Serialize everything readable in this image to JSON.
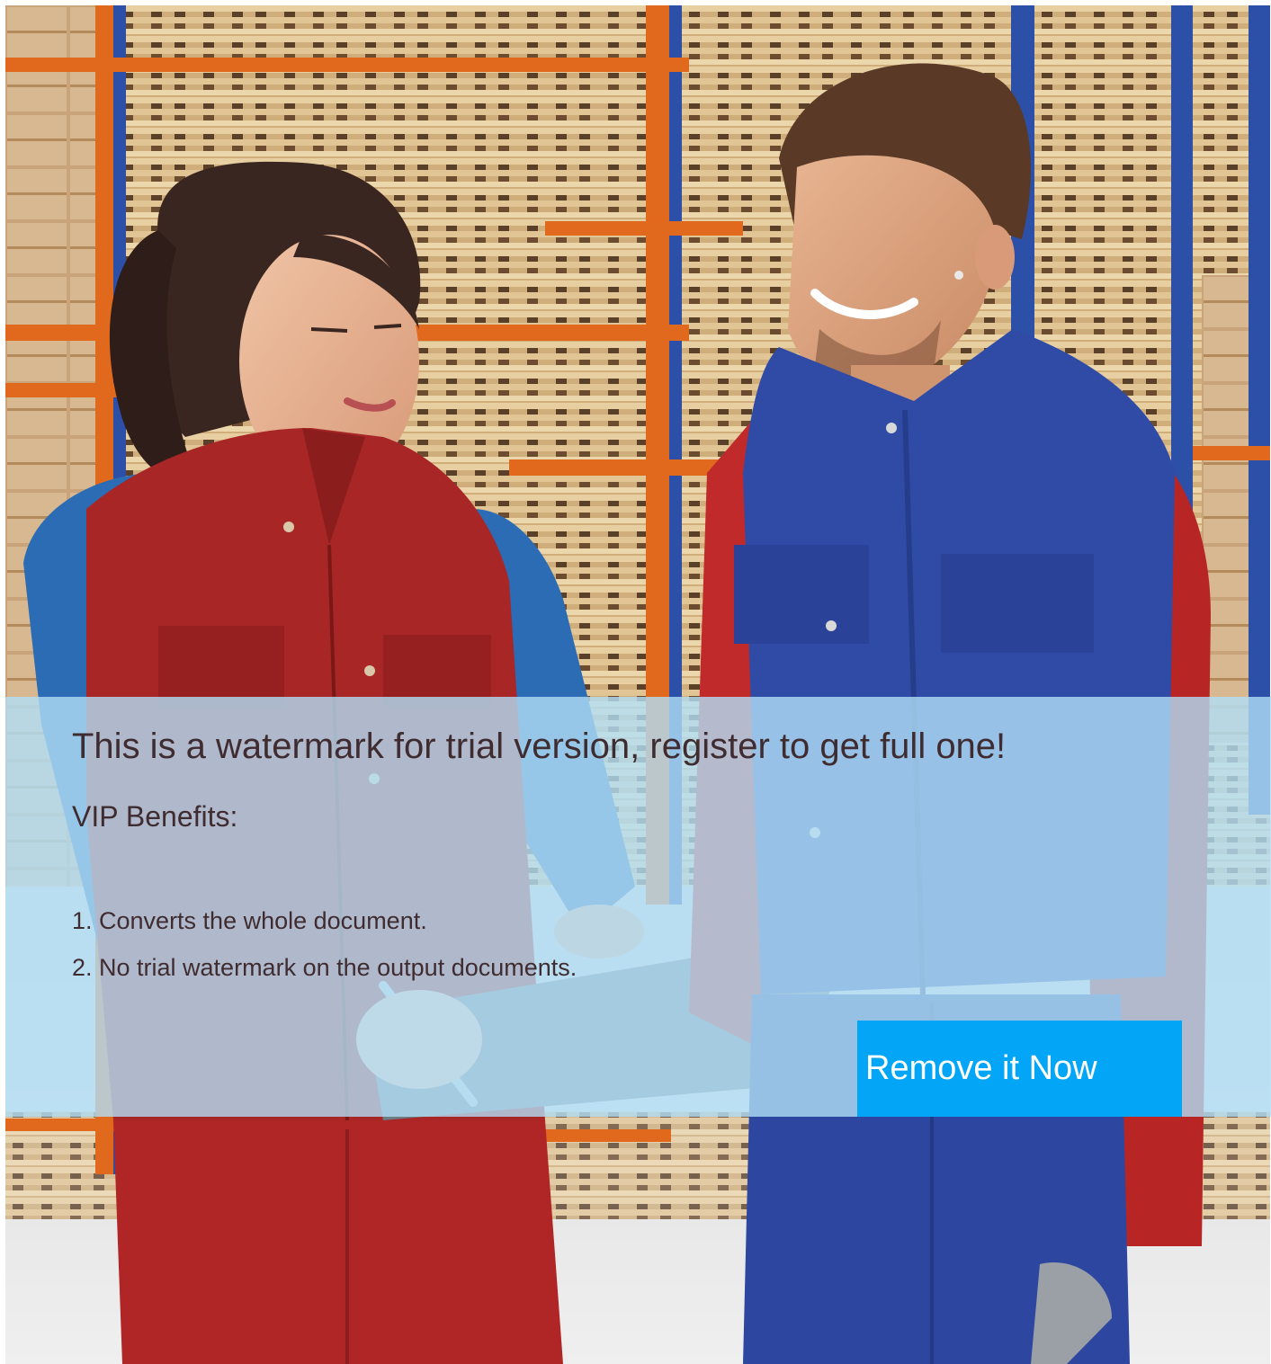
{
  "watermark": {
    "title": "This is a watermark for trial version, register to get full one!",
    "subtitle": "VIP Benefits:",
    "benefits": [
      "1. Converts the whole document.",
      "2. No trial watermark on the output documents."
    ],
    "button_label": "Remove it Now"
  },
  "colors": {
    "overlay": "#b2def6",
    "text": "#3f2c30",
    "button": "#03a6f7",
    "button_text": "#ffffff",
    "rack_orange": "#e0691e",
    "rack_blue": "#2c4fa8",
    "pallet_wood": "#d8b98a",
    "red_vest": "#a82626",
    "blue_vest": "#2f4ba6"
  },
  "photo": {
    "subject": "two warehouse workers in uniforms reviewing a clipboard"
  }
}
